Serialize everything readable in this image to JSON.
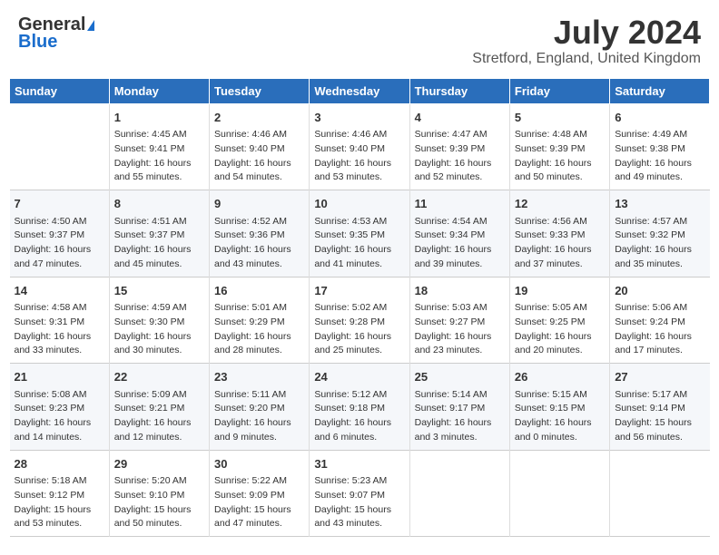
{
  "header": {
    "logo_general": "General",
    "logo_blue": "Blue",
    "title": "July 2024",
    "subtitle": "Stretford, England, United Kingdom"
  },
  "days_header": [
    "Sunday",
    "Monday",
    "Tuesday",
    "Wednesday",
    "Thursday",
    "Friday",
    "Saturday"
  ],
  "weeks": [
    [
      {
        "num": "",
        "lines": []
      },
      {
        "num": "1",
        "lines": [
          "Sunrise: 4:45 AM",
          "Sunset: 9:41 PM",
          "Daylight: 16 hours",
          "and 55 minutes."
        ]
      },
      {
        "num": "2",
        "lines": [
          "Sunrise: 4:46 AM",
          "Sunset: 9:40 PM",
          "Daylight: 16 hours",
          "and 54 minutes."
        ]
      },
      {
        "num": "3",
        "lines": [
          "Sunrise: 4:46 AM",
          "Sunset: 9:40 PM",
          "Daylight: 16 hours",
          "and 53 minutes."
        ]
      },
      {
        "num": "4",
        "lines": [
          "Sunrise: 4:47 AM",
          "Sunset: 9:39 PM",
          "Daylight: 16 hours",
          "and 52 minutes."
        ]
      },
      {
        "num": "5",
        "lines": [
          "Sunrise: 4:48 AM",
          "Sunset: 9:39 PM",
          "Daylight: 16 hours",
          "and 50 minutes."
        ]
      },
      {
        "num": "6",
        "lines": [
          "Sunrise: 4:49 AM",
          "Sunset: 9:38 PM",
          "Daylight: 16 hours",
          "and 49 minutes."
        ]
      }
    ],
    [
      {
        "num": "7",
        "lines": [
          "Sunrise: 4:50 AM",
          "Sunset: 9:37 PM",
          "Daylight: 16 hours",
          "and 47 minutes."
        ]
      },
      {
        "num": "8",
        "lines": [
          "Sunrise: 4:51 AM",
          "Sunset: 9:37 PM",
          "Daylight: 16 hours",
          "and 45 minutes."
        ]
      },
      {
        "num": "9",
        "lines": [
          "Sunrise: 4:52 AM",
          "Sunset: 9:36 PM",
          "Daylight: 16 hours",
          "and 43 minutes."
        ]
      },
      {
        "num": "10",
        "lines": [
          "Sunrise: 4:53 AM",
          "Sunset: 9:35 PM",
          "Daylight: 16 hours",
          "and 41 minutes."
        ]
      },
      {
        "num": "11",
        "lines": [
          "Sunrise: 4:54 AM",
          "Sunset: 9:34 PM",
          "Daylight: 16 hours",
          "and 39 minutes."
        ]
      },
      {
        "num": "12",
        "lines": [
          "Sunrise: 4:56 AM",
          "Sunset: 9:33 PM",
          "Daylight: 16 hours",
          "and 37 minutes."
        ]
      },
      {
        "num": "13",
        "lines": [
          "Sunrise: 4:57 AM",
          "Sunset: 9:32 PM",
          "Daylight: 16 hours",
          "and 35 minutes."
        ]
      }
    ],
    [
      {
        "num": "14",
        "lines": [
          "Sunrise: 4:58 AM",
          "Sunset: 9:31 PM",
          "Daylight: 16 hours",
          "and 33 minutes."
        ]
      },
      {
        "num": "15",
        "lines": [
          "Sunrise: 4:59 AM",
          "Sunset: 9:30 PM",
          "Daylight: 16 hours",
          "and 30 minutes."
        ]
      },
      {
        "num": "16",
        "lines": [
          "Sunrise: 5:01 AM",
          "Sunset: 9:29 PM",
          "Daylight: 16 hours",
          "and 28 minutes."
        ]
      },
      {
        "num": "17",
        "lines": [
          "Sunrise: 5:02 AM",
          "Sunset: 9:28 PM",
          "Daylight: 16 hours",
          "and 25 minutes."
        ]
      },
      {
        "num": "18",
        "lines": [
          "Sunrise: 5:03 AM",
          "Sunset: 9:27 PM",
          "Daylight: 16 hours",
          "and 23 minutes."
        ]
      },
      {
        "num": "19",
        "lines": [
          "Sunrise: 5:05 AM",
          "Sunset: 9:25 PM",
          "Daylight: 16 hours",
          "and 20 minutes."
        ]
      },
      {
        "num": "20",
        "lines": [
          "Sunrise: 5:06 AM",
          "Sunset: 9:24 PM",
          "Daylight: 16 hours",
          "and 17 minutes."
        ]
      }
    ],
    [
      {
        "num": "21",
        "lines": [
          "Sunrise: 5:08 AM",
          "Sunset: 9:23 PM",
          "Daylight: 16 hours",
          "and 14 minutes."
        ]
      },
      {
        "num": "22",
        "lines": [
          "Sunrise: 5:09 AM",
          "Sunset: 9:21 PM",
          "Daylight: 16 hours",
          "and 12 minutes."
        ]
      },
      {
        "num": "23",
        "lines": [
          "Sunrise: 5:11 AM",
          "Sunset: 9:20 PM",
          "Daylight: 16 hours",
          "and 9 minutes."
        ]
      },
      {
        "num": "24",
        "lines": [
          "Sunrise: 5:12 AM",
          "Sunset: 9:18 PM",
          "Daylight: 16 hours",
          "and 6 minutes."
        ]
      },
      {
        "num": "25",
        "lines": [
          "Sunrise: 5:14 AM",
          "Sunset: 9:17 PM",
          "Daylight: 16 hours",
          "and 3 minutes."
        ]
      },
      {
        "num": "26",
        "lines": [
          "Sunrise: 5:15 AM",
          "Sunset: 9:15 PM",
          "Daylight: 16 hours",
          "and 0 minutes."
        ]
      },
      {
        "num": "27",
        "lines": [
          "Sunrise: 5:17 AM",
          "Sunset: 9:14 PM",
          "Daylight: 15 hours",
          "and 56 minutes."
        ]
      }
    ],
    [
      {
        "num": "28",
        "lines": [
          "Sunrise: 5:18 AM",
          "Sunset: 9:12 PM",
          "Daylight: 15 hours",
          "and 53 minutes."
        ]
      },
      {
        "num": "29",
        "lines": [
          "Sunrise: 5:20 AM",
          "Sunset: 9:10 PM",
          "Daylight: 15 hours",
          "and 50 minutes."
        ]
      },
      {
        "num": "30",
        "lines": [
          "Sunrise: 5:22 AM",
          "Sunset: 9:09 PM",
          "Daylight: 15 hours",
          "and 47 minutes."
        ]
      },
      {
        "num": "31",
        "lines": [
          "Sunrise: 5:23 AM",
          "Sunset: 9:07 PM",
          "Daylight: 15 hours",
          "and 43 minutes."
        ]
      },
      {
        "num": "",
        "lines": []
      },
      {
        "num": "",
        "lines": []
      },
      {
        "num": "",
        "lines": []
      }
    ]
  ]
}
